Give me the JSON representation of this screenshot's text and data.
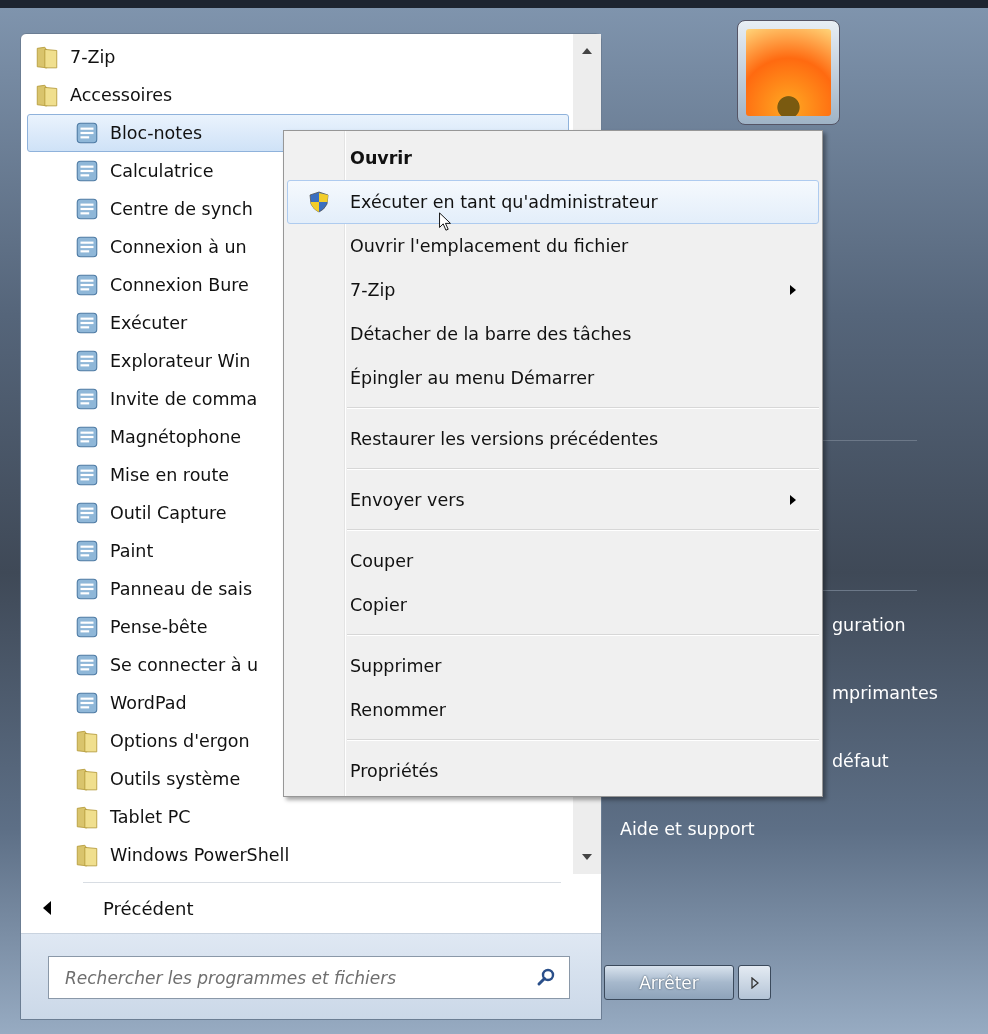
{
  "programs": [
    {
      "label": "7-Zip",
      "kind": "folder",
      "selected": false
    },
    {
      "label": "Accessoires",
      "kind": "folder",
      "selected": false,
      "children": [
        {
          "label": "Bloc-notes",
          "kind": "program",
          "selected": true
        },
        {
          "label": "Calculatrice",
          "kind": "program",
          "selected": false
        },
        {
          "label": "Centre de synch",
          "kind": "program",
          "selected": false
        },
        {
          "label": "Connexion à un",
          "kind": "program",
          "selected": false
        },
        {
          "label": "Connexion Bure",
          "kind": "program",
          "selected": false
        },
        {
          "label": "Exécuter",
          "kind": "program",
          "selected": false
        },
        {
          "label": "Explorateur Win",
          "kind": "program",
          "selected": false
        },
        {
          "label": "Invite de comma",
          "kind": "program",
          "selected": false
        },
        {
          "label": "Magnétophone",
          "kind": "program",
          "selected": false
        },
        {
          "label": "Mise en route",
          "kind": "program",
          "selected": false
        },
        {
          "label": "Outil Capture",
          "kind": "program",
          "selected": false
        },
        {
          "label": "Paint",
          "kind": "program",
          "selected": false
        },
        {
          "label": "Panneau de sais",
          "kind": "program",
          "selected": false
        },
        {
          "label": "Pense-bête",
          "kind": "program",
          "selected": false
        },
        {
          "label": "Se connecter à u",
          "kind": "program",
          "selected": false
        },
        {
          "label": "WordPad",
          "kind": "program",
          "selected": false
        },
        {
          "label": "Options d'ergon",
          "kind": "folder",
          "selected": false
        },
        {
          "label": "Outils système",
          "kind": "folder",
          "selected": false
        },
        {
          "label": "Tablet PC",
          "kind": "folder",
          "selected": false
        },
        {
          "label": "Windows PowerShell",
          "kind": "folder",
          "selected": false
        }
      ]
    }
  ],
  "back": {
    "label": "Précédent"
  },
  "search": {
    "placeholder": "Rechercher les programmes et fichiers"
  },
  "right_panel": [
    {
      "label": "guration",
      "covered": true
    },
    {
      "label": "mprimantes",
      "covered": true
    },
    {
      "label": "défaut",
      "covered": true
    },
    {
      "label": "Aide et support",
      "covered": false
    }
  ],
  "shutdown": {
    "label": "Arrêter"
  },
  "context_menu": [
    [
      {
        "label": "Ouvrir",
        "bold": true,
        "highlighted": false,
        "submenu": false,
        "kind": "plain"
      },
      {
        "label": "Exécuter en tant qu'administrateur",
        "bold": false,
        "highlighted": true,
        "submenu": false,
        "kind": "shield"
      },
      {
        "label": "Ouvrir l'emplacement du fichier",
        "bold": false,
        "highlighted": false,
        "submenu": false,
        "kind": "plain"
      },
      {
        "label": "7-Zip",
        "bold": false,
        "highlighted": false,
        "submenu": true,
        "kind": "plain"
      },
      {
        "label": "Détacher de la barre des tâches",
        "bold": false,
        "highlighted": false,
        "submenu": false,
        "kind": "plain"
      },
      {
        "label": "Épingler au menu Démarrer",
        "bold": false,
        "highlighted": false,
        "submenu": false,
        "kind": "plain"
      }
    ],
    [
      {
        "label": "Restaurer les versions précédentes",
        "bold": false,
        "highlighted": false,
        "submenu": false,
        "kind": "plain"
      }
    ],
    [
      {
        "label": "Envoyer vers",
        "bold": false,
        "highlighted": false,
        "submenu": true,
        "kind": "plain"
      }
    ],
    [
      {
        "label": "Couper",
        "bold": false,
        "highlighted": false,
        "submenu": false,
        "kind": "plain"
      },
      {
        "label": "Copier",
        "bold": false,
        "highlighted": false,
        "submenu": false,
        "kind": "plain"
      }
    ],
    [
      {
        "label": "Supprimer",
        "bold": false,
        "highlighted": false,
        "submenu": false,
        "kind": "plain"
      },
      {
        "label": "Renommer",
        "bold": false,
        "highlighted": false,
        "submenu": false,
        "kind": "plain"
      }
    ],
    [
      {
        "label": "Propriétés",
        "bold": false,
        "highlighted": false,
        "submenu": false,
        "kind": "plain"
      }
    ]
  ]
}
